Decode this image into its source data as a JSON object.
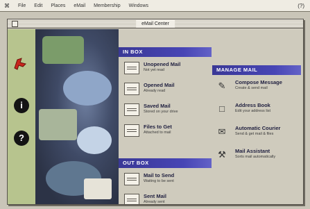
{
  "menubar": {
    "apple": "⌘",
    "items": [
      "File",
      "Edit",
      "Places",
      "eMail",
      "Membership",
      "Windows"
    ],
    "right": "(?)"
  },
  "window": {
    "title": "eMail Center"
  },
  "inbox": {
    "header": "IN BOX",
    "items": [
      {
        "name": "Unopened Mail",
        "sub": "Not yet read",
        "icon": "mailbox-icon"
      },
      {
        "name": "Opened Mail",
        "sub": "Already read",
        "icon": "mailbox-icon"
      },
      {
        "name": "Saved Mail",
        "sub": "Stored on your drive",
        "icon": "mailbox-icon"
      },
      {
        "name": "Files to Get",
        "sub": "Attached to mail",
        "icon": "folder-icon"
      }
    ]
  },
  "outbox": {
    "header": "OUT BOX",
    "items": [
      {
        "name": "Mail to Send",
        "sub": "Waiting to be sent",
        "icon": "folder-icon"
      },
      {
        "name": "Sent Mail",
        "sub": "Already sent",
        "icon": "folder-icon"
      }
    ]
  },
  "manage": {
    "header": "MANAGE MAIL",
    "items": [
      {
        "name": "Compose Message",
        "sub": "Create & send mail",
        "glyph": "✎"
      },
      {
        "name": "Address Book",
        "sub": "Edit your address list",
        "glyph": "□"
      },
      {
        "name": "Automatic Courier",
        "sub": "Send & get mail & files",
        "glyph": "✉"
      },
      {
        "name": "Mail Assistant",
        "sub": "Sorts mail automatically",
        "glyph": "⚒"
      }
    ]
  },
  "sidebar": {
    "info_glyph": "i",
    "help_glyph": "?"
  },
  "colors": {
    "header_blue": "#3a3896",
    "sidebar_green": "#b7c48e"
  }
}
